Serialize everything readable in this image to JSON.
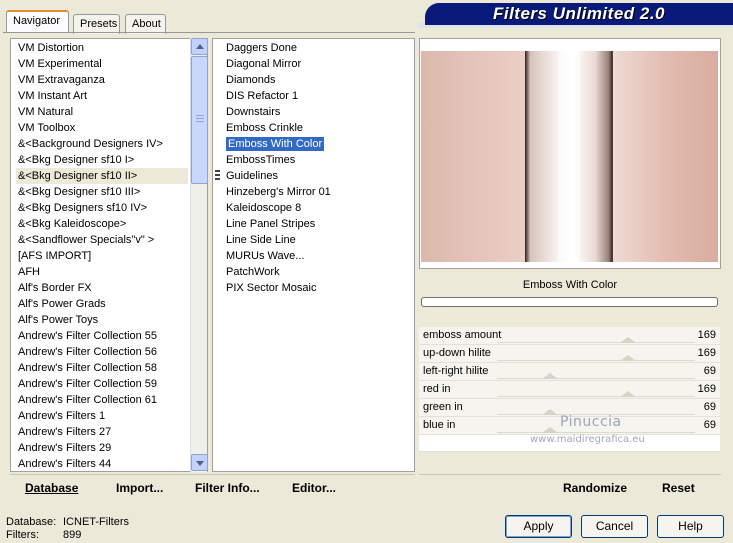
{
  "tabs": [
    {
      "label": "Navigator",
      "active": true
    },
    {
      "label": "Presets",
      "active": false
    },
    {
      "label": "About",
      "active": false
    }
  ],
  "banner_title": "Filters Unlimited 2.0",
  "categories": [
    "VM Distortion",
    "VM Experimental",
    "VM Extravaganza",
    "VM Instant Art",
    "VM Natural",
    "VM Toolbox",
    "&<Background Designers IV>",
    "&<Bkg Designer sf10 I>",
    "&<Bkg Designer sf10 II>",
    "&<Bkg Designer sf10 III>",
    "&<Bkg Designers sf10 IV>",
    "&<Bkg Kaleidoscope>",
    "&<Sandflower Specials\"v\" >",
    "[AFS IMPORT]",
    "AFH",
    "Alf's Border FX",
    "Alf's Power Grads",
    "Alf's Power Toys",
    "Andrew's Filter Collection 55",
    "Andrew's Filter Collection 56",
    "Andrew's Filter Collection 58",
    "Andrew's Filter Collection 59",
    "Andrew's Filter Collection 61",
    "Andrew's Filters 1",
    "Andrew's Filters 27",
    "Andrew's Filters 29",
    "Andrew's Filters 44"
  ],
  "selected_category_index": 8,
  "filters": [
    "Daggers Done",
    "Diagonal Mirror",
    "Diamonds",
    "DIS Refactor 1",
    "Downstairs",
    "Emboss Crinkle",
    "Emboss With Color",
    "EmbossTimes",
    "Guidelines",
    "Hinzeberg's Mirror 01",
    "Kaleidoscope 8",
    "Line Panel Stripes",
    "Line Side Line",
    "MURUs Wave...",
    "PatchWork",
    "PIX Sector Mosaic"
  ],
  "selected_filter_index": 6,
  "filter_caption": "Emboss With Color",
  "params": [
    {
      "label": "emboss amount",
      "value": "169",
      "fraction": 0.66
    },
    {
      "label": "up-down hilite",
      "value": "169",
      "fraction": 0.66
    },
    {
      "label": "left-right hilite",
      "value": "69",
      "fraction": 0.27
    },
    {
      "label": "red in",
      "value": "169",
      "fraction": 0.66
    },
    {
      "label": "green in",
      "value": "69",
      "fraction": 0.27
    },
    {
      "label": "blue in",
      "value": "69",
      "fraction": 0.27
    }
  ],
  "watermark": {
    "name": "Pinuccia",
    "site": "www.maidiregrafica.eu"
  },
  "left_bar": {
    "database": "Database",
    "import": "Import...",
    "filter_info": "Filter Info...",
    "editor": "Editor..."
  },
  "right_bar": {
    "randomize": "Randomize",
    "reset": "Reset"
  },
  "status": {
    "db_label": "Database:",
    "db_value": "ICNET-Filters",
    "filters_label": "Filters:",
    "filters_value": "899"
  },
  "buttons": {
    "apply": "Apply",
    "cancel": "Cancel",
    "help": "Help"
  },
  "colors": {
    "selection": "#316ac5",
    "banner": "#0a1a7a",
    "dialog": "#ece9d8"
  }
}
